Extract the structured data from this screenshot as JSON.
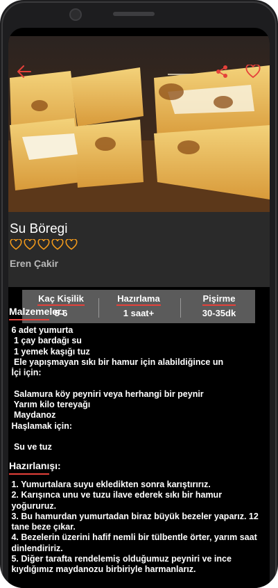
{
  "recipe": {
    "title": "Su Böregi",
    "rating": 5,
    "author": "Eren Çakir"
  },
  "stats": [
    {
      "label": "Kaç Kişilik",
      "value": "5-6"
    },
    {
      "label": "Hazırlama",
      "value": "1 saat+"
    },
    {
      "label": "Pişirme",
      "value": "30-35dk"
    }
  ],
  "ingredients": {
    "heading": "Malzemeler:",
    "text": " 6 adet yumurta\n  1 çay bardağı su\n  1 yemek kaşığı tuz\n  Ele yapışmayan sıkı bir hamur için alabildiğince un\n İçi için:\n\n  Salamura köy peyniri veya herhangi bir peynir\n  Yarım kilo tereyağı\n  Maydanoz\n Haşlamak için:\n\n  Su ve tuz"
  },
  "preparation": {
    "heading": "Hazırlanışı:",
    "text": " 1. Yumurtalara suyu ekledikten sonra karıştırırız.\n 2. Karışınca unu ve tuzu ilave ederek sıkı bir hamur\n yoğururuz.\n 3. Bu hamurdan yumurtadan biraz büyük bezeler yaparız. 12\n tane beze çıkar.\n 4. Bezelerin üzerini hafif nemli bir tülbentle örter, yarım saat\n dinlendiririz.\n 5. Diğer tarafta rendelemiş olduğumuz peyniri ve ince\n kıydığımız maydanozu birbiriyle harmanlarız."
  },
  "icons": {
    "back": "arrow-left-icon",
    "share": "share-icon",
    "favorite": "heart-icon",
    "rating": "heart-outline-icon"
  },
  "colors": {
    "accent": "#e5413a",
    "rating": "#f39a1b",
    "panel": "#2a2a2a",
    "stats": "#5b5b5b"
  }
}
